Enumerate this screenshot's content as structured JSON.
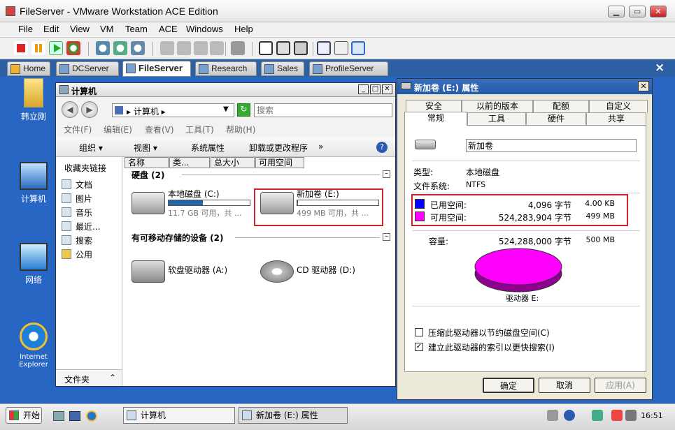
{
  "vm": {
    "title": "FileServer - VMware Workstation ACE Edition",
    "menu": [
      "File",
      "Edit",
      "View",
      "VM",
      "Team",
      "ACE",
      "Windows",
      "Help"
    ],
    "tabs": [
      {
        "label": "Home",
        "active": false
      },
      {
        "label": "DCServer",
        "active": false
      },
      {
        "label": "FileServer",
        "active": true
      },
      {
        "label": "Research",
        "active": false
      },
      {
        "label": "Sales",
        "active": false
      },
      {
        "label": "ProfileServer",
        "active": false
      }
    ],
    "tabs_close": "×"
  },
  "desktop": {
    "icons": [
      "韩立刚",
      "计算机",
      "网络",
      "Internet Explorer"
    ]
  },
  "explorer": {
    "title": "计算机",
    "address": "▸ 计算机 ▸",
    "search_placeholder": "搜索",
    "menu": [
      "文件(F)",
      "编辑(E)",
      "查看(V)",
      "工具(T)",
      "帮助(H)"
    ],
    "commands": [
      "组织 ▾",
      "视图 ▾",
      "系统属性",
      "卸载或更改程序",
      "»"
    ],
    "nav_header": "收藏夹链接",
    "nav_items": [
      "文档",
      "图片",
      "音乐",
      "最近...",
      "搜索",
      "公用"
    ],
    "nav_folders": "文件夹",
    "columns": [
      "名称",
      "类...",
      "总大小",
      "可用空间"
    ],
    "group_hdd": "硬盘 (2)",
    "group_removable": "有可移动存储的设备 (2)",
    "drives": [
      {
        "name": "本地磁盘 (C:)",
        "sub": "11.7 GB 可用，共 ...",
        "used": 0.42
      },
      {
        "name": "新加卷 (E:)",
        "sub": "499 MB 可用，共 ...",
        "used": 0.01
      }
    ],
    "removable": [
      {
        "name": "软盘驱动器 (A:)"
      },
      {
        "name": "CD 驱动器 (D:)"
      }
    ]
  },
  "props": {
    "title": "新加卷 (E:) 属性",
    "tabs_row1": [
      "安全",
      "以前的版本",
      "配额",
      "自定义"
    ],
    "tabs_row2": [
      "常规",
      "工具",
      "硬件",
      "共享"
    ],
    "volume_name": "新加卷",
    "type_label": "类型:",
    "type_value": "本地磁盘",
    "fs_label": "文件系统:",
    "fs_value": "NTFS",
    "used_label": "已用空间:",
    "used_bytes": "4,096 字节",
    "used_size": "4.00 KB",
    "free_label": "可用空间:",
    "free_bytes": "524,283,904 字节",
    "free_size": "499 MB",
    "cap_label": "容量:",
    "cap_bytes": "524,288,000 字节",
    "cap_size": "500 MB",
    "drive_label": "驱动器 E:",
    "compress_label": "压缩此驱动器以节约磁盘空间(C)",
    "compress_checked": false,
    "index_label": "建立此驱动器的索引以更快搜索(I)",
    "index_checked": true,
    "ok": "确定",
    "cancel": "取消",
    "apply": "应用(A)",
    "colors": {
      "used": "#0000ff",
      "free": "#ff00ff"
    }
  },
  "taskbar": {
    "start": "开始",
    "tasks": [
      "计算机",
      "新加卷 (E:) 属性"
    ],
    "clock": "16:51"
  }
}
